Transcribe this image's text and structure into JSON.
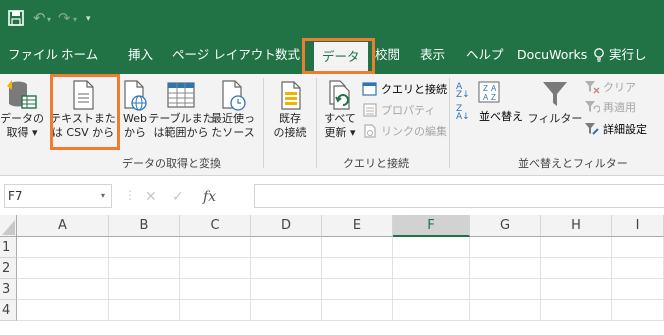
{
  "colors": {
    "brand_green": "#217346",
    "ribbon_bg": "#f3f3f3",
    "highlight_orange": "#ee7d31"
  },
  "tabs": [
    {
      "label": "ファイル"
    },
    {
      "label": "ホーム"
    },
    {
      "label": "挿入"
    },
    {
      "label": "ページ レイアウト"
    },
    {
      "label": "数式"
    },
    {
      "label": "データ",
      "active": true
    },
    {
      "label": "校閲"
    },
    {
      "label": "表示"
    },
    {
      "label": "ヘルプ"
    },
    {
      "label": "DocuWorks"
    },
    {
      "label": "実行し"
    }
  ],
  "ribbon": {
    "get_data": {
      "l1": "データの",
      "l2": "取得 ▾"
    },
    "from_text_csv": {
      "l1": "テキストまた",
      "l2": "は CSV から"
    },
    "from_web": {
      "l1": "Web",
      "l2": "から"
    },
    "from_table": {
      "l1": "テーブルまた",
      "l2": "は範囲から"
    },
    "recent_sources": {
      "l1": "最近使っ",
      "l2": "たソース"
    },
    "existing_conn": {
      "l1": "既存",
      "l2": "の接続"
    },
    "refresh_all": {
      "l1": "すべて",
      "l2": "更新 ▾"
    },
    "queries_conn": "クエリと接続",
    "properties": "プロパティ",
    "edit_links": "リンクの編集",
    "sort": "並べ替え",
    "filter": "フィルター",
    "clear": "クリア",
    "reapply": "再適用",
    "advanced": "詳細設定",
    "group_get_transform": "データの取得と変換",
    "group_queries": "クエリと接続",
    "group_sort_filter": "並べ替えとフィルター"
  },
  "formula_bar": {
    "name_box": "F7",
    "fx": "fx",
    "value": ""
  },
  "grid": {
    "columns": [
      "A",
      "B",
      "C",
      "D",
      "E",
      "F",
      "G",
      "H",
      "I"
    ],
    "rows": [
      "1",
      "2",
      "3",
      "4"
    ],
    "selected_column": "F"
  }
}
